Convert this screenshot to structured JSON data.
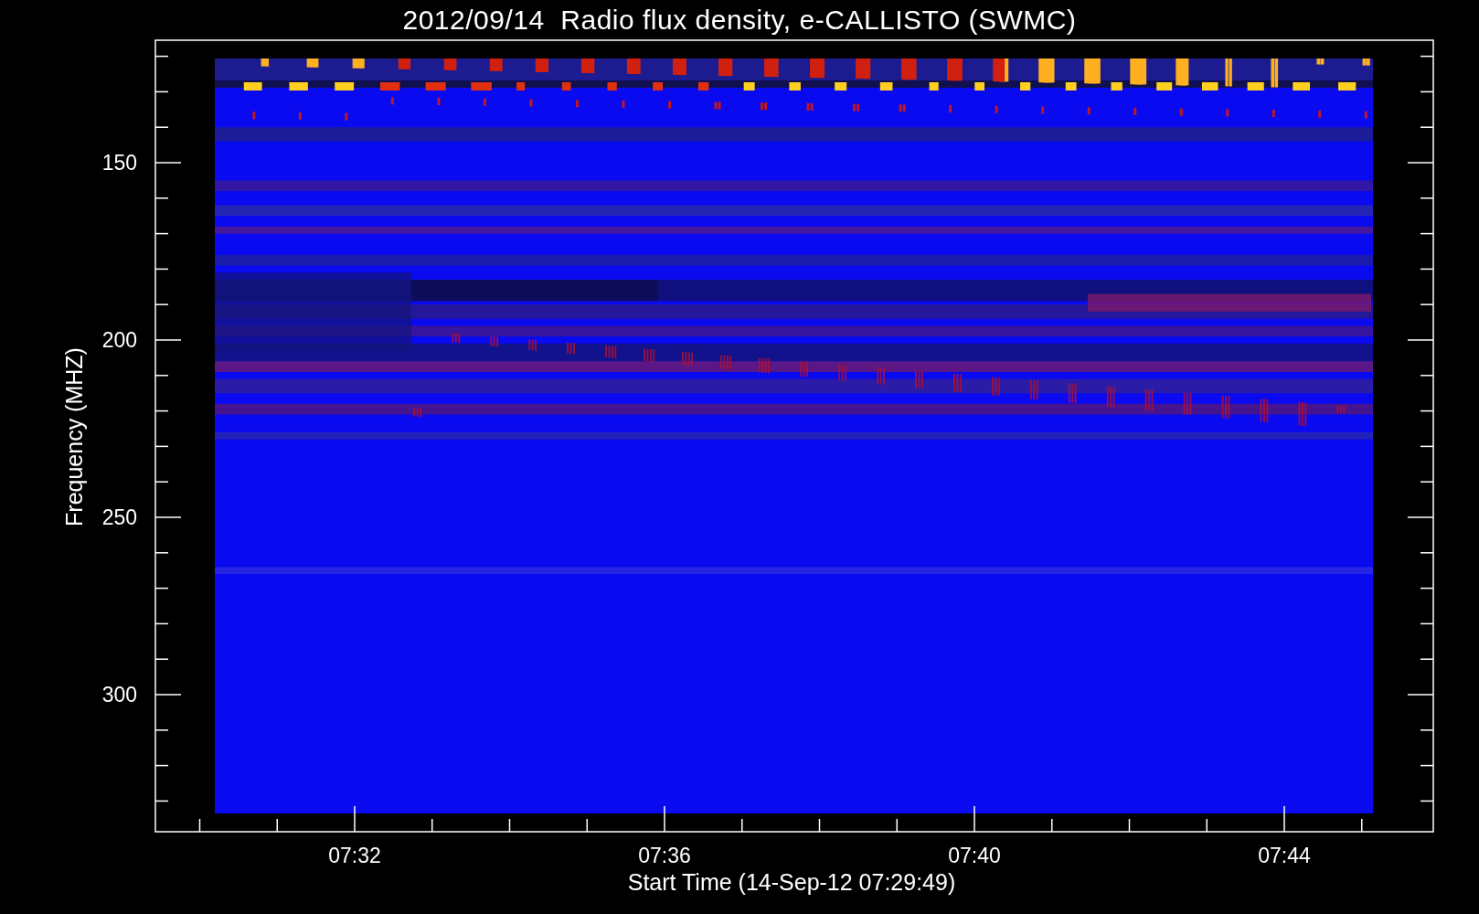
{
  "title": "2012/09/14  Radio flux density, e-CALLISTO (SWMC)",
  "y_axis": {
    "label": "Frequency (MHZ)",
    "ticks": [
      "150",
      "200",
      "250",
      "300"
    ]
  },
  "x_axis": {
    "label": "Start Time (14-Sep-12 07:29:49)",
    "ticks": [
      "07:32",
      "07:36",
      "07:40",
      "07:44"
    ]
  }
}
